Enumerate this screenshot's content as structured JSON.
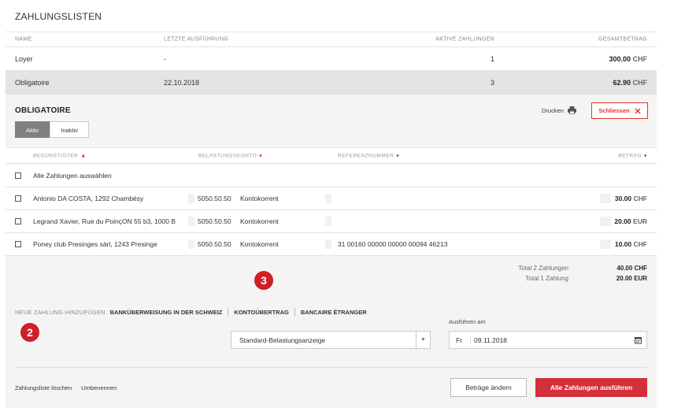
{
  "page": {
    "title": "ZAHLUNGSLISTEN"
  },
  "list_table": {
    "headers": {
      "name": "NAME",
      "last_run": "LETZTE AUSFÜHRUNG",
      "active": "AKTIVE ZAHLUNGEN",
      "total": "GESAMTBETRAG"
    },
    "rows": [
      {
        "name": "Loyer",
        "last_run": "-",
        "active": "1",
        "amount": "300.00",
        "currency": "CHF",
        "selected": false
      },
      {
        "name": "Obligatoire",
        "last_run": "22.10.2018",
        "active": "3",
        "amount": "62.90",
        "currency": "CHF",
        "selected": true
      }
    ]
  },
  "detail": {
    "title": "OBLIGATOIRE",
    "tabs": [
      {
        "label": "Aktiv",
        "active": true
      },
      {
        "label": "Inaktiv",
        "active": false
      }
    ],
    "print_label": "Drucken",
    "close_label": "Schliessen",
    "payments_headers": {
      "beneficiary": "BEGÜNSTIGTER",
      "account": "BELASTUNGSKONTO",
      "reference": "REFERENZNUMMER",
      "amount": "BETRAG"
    },
    "select_all_label": "Alle Zahlungen auswählen",
    "payments": [
      {
        "beneficiary": "Antonio DA COSTA, 1292 Chambésy",
        "account": "5050.50.50",
        "account_type": "Kontokorrent",
        "reference": "",
        "amount": "30.00",
        "currency": "CHF"
      },
      {
        "beneficiary": "Legrand Xavier, Rue du PoinçON 55 b3, 1000 B",
        "account": "5050.50.50",
        "account_type": "Kontokorrent",
        "reference": "",
        "amount": "20.00",
        "currency": "EUR"
      },
      {
        "beneficiary": "Poney club Presinges sàrl, 1243 Presinge",
        "account": "5050.50.50",
        "account_type": "Kontokorrent",
        "reference": "31 00160 00000 00000 00094 46213",
        "amount": "10.00",
        "currency": "CHF"
      }
    ],
    "totals": [
      {
        "label": "Total 2 Zahlungen",
        "value": "40.00 CHF"
      },
      {
        "label": "Total 1 Zahlung",
        "value": "20.00 EUR"
      }
    ]
  },
  "new_payment": {
    "label": "NEUE ZAHLUNG HINZUFÜGEN",
    "links": [
      "BANKÜBERWEISUNG IN DER SCHWEIZ",
      "KONTOÜBERTRAG",
      "BANCAIRE ÉTRANGER"
    ]
  },
  "badges": [
    "2",
    "3"
  ],
  "debit_select": {
    "value": "Standard-Belastungsanzeige"
  },
  "execute": {
    "label": "Ausführen am",
    "weekday": "Fr",
    "date": "09.11.2018"
  },
  "footer": {
    "links": [
      "Zahlungsliste löschen",
      "Umbenennen"
    ],
    "change_amounts_label": "Beträge ändern",
    "execute_all_label": "Alle Zahlungen ausführen"
  },
  "colors": {
    "accent": "#d3303a",
    "badge": "#cf2027",
    "tab_active": "#7d8083",
    "panel_bg": "#f4f4f4",
    "selected_row": "#e4e4e4"
  },
  "icons": {
    "print": "printer-icon",
    "close": "close-icon",
    "sort": "sort-arrow-icon",
    "dropdown": "chevron-down-icon",
    "calendar": "calendar-icon"
  }
}
